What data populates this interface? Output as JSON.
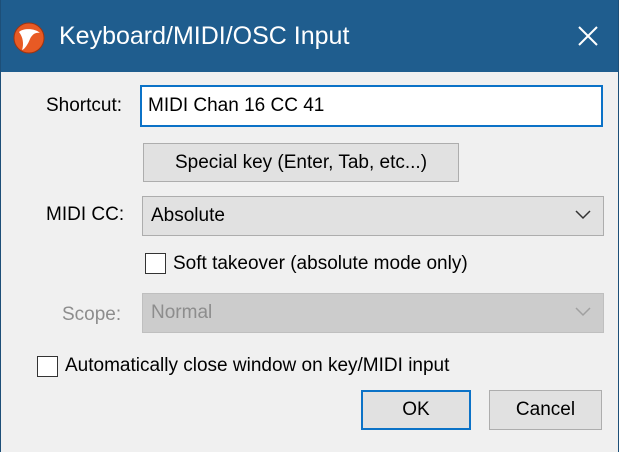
{
  "window": {
    "title": "Keyboard/MIDI/OSC Input",
    "app_icon": "reaper-logo-icon",
    "close_icon": "close-icon"
  },
  "shortcut": {
    "label": "Shortcut:",
    "value": "MIDI Chan 16 CC 41"
  },
  "special_key_button": {
    "label": "Special key (Enter, Tab, etc...)"
  },
  "midi_cc": {
    "label": "MIDI CC:",
    "selected": "Absolute",
    "chevron_icon": "chevron-down-icon"
  },
  "soft_takeover": {
    "label": "Soft takeover (absolute mode only)",
    "checked": false
  },
  "scope": {
    "label": "Scope:",
    "selected": "Normal",
    "disabled": true,
    "chevron_icon": "chevron-down-icon"
  },
  "auto_close": {
    "label": "Automatically close window on key/MIDI input",
    "checked": false
  },
  "buttons": {
    "ok": "OK",
    "cancel": "Cancel"
  },
  "colors": {
    "titlebar": "#1f5d8e",
    "focus_border": "#0b72c7",
    "dialog_bg": "#f0f0f0"
  }
}
